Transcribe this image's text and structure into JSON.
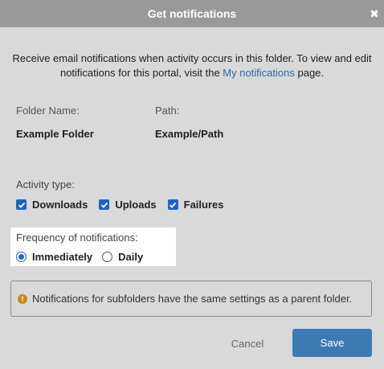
{
  "header": {
    "title": "Get notifications",
    "close_icon": "close-icon"
  },
  "intro": {
    "text_before": "Receive email notifications when activity occurs in this folder. To view and edit notifications for this portal, visit the ",
    "link_text": "My notifications",
    "text_after": " page."
  },
  "folder": {
    "name_label": "Folder Name:",
    "name_value": "Example Folder",
    "path_label": "Path:",
    "path_value": "Example/Path"
  },
  "activity": {
    "label": "Activity type:",
    "options": [
      {
        "label": "Downloads",
        "checked": true
      },
      {
        "label": "Uploads",
        "checked": true
      },
      {
        "label": "Failures",
        "checked": true
      }
    ]
  },
  "frequency": {
    "label": "Frequency of notifications:",
    "options": [
      {
        "label": "Immediately",
        "selected": true
      },
      {
        "label": "Daily",
        "selected": false
      }
    ]
  },
  "notice": {
    "icon": "warning-icon",
    "text": "Notifications for subfolders have the same settings as a parent folder."
  },
  "footer": {
    "cancel_label": "Cancel",
    "save_label": "Save"
  },
  "colors": {
    "header_bg": "#999999",
    "page_bg": "#d9d9d9",
    "accent": "#1f63c6",
    "save_bg": "#3d79b4",
    "link": "#2a6aa6",
    "warning": "#c98a14"
  }
}
